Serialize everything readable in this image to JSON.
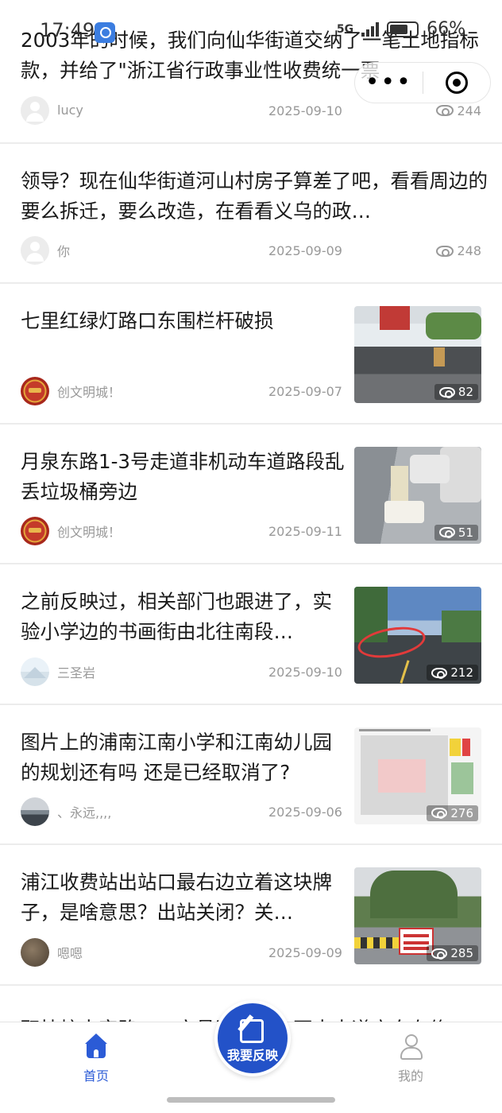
{
  "status_bar": {
    "time": "17:49",
    "network": "5G",
    "battery": "66%"
  },
  "capsule": {
    "more_icon": "more-dots-icon",
    "close_icon": "target-close-icon"
  },
  "feed": [
    {
      "title": "2003年的时候，我们向仙华街道交纳了一笔土地指标款，并给了\"浙江省行政事业性收费统一票",
      "author": "lucy",
      "date": "2025-09-10",
      "views": "244",
      "thumb": false
    },
    {
      "title": "领导？现在仙华街道河山村房子算差了吧，看看周边的要么拆迁，要么改造，在看看义乌的政…",
      "author": "你",
      "date": "2025-09-09",
      "views": "248",
      "thumb": false
    },
    {
      "title": "七里红绿灯路口东围栏杆破损",
      "author": "创文明城！",
      "date": "2025-09-07",
      "views": "82",
      "thumb": true
    },
    {
      "title": "月泉东路1-3号走道非机动车道路段乱丢垃圾桶旁边",
      "author": "创文明城！",
      "date": "2025-09-11",
      "views": "51",
      "thumb": true
    },
    {
      "title": "之前反映过，相关部门也跟进了，实验小学边的书画街由北往南段…",
      "author": "三圣岩",
      "date": "2025-09-10",
      "views": "212",
      "thumb": true
    },
    {
      "title": "图片上的浦南江南小学和江南幼儿园的规划还有吗 还是已经取消了?",
      "author": "、永远,,,,",
      "date": "2025-09-06",
      "views": "276",
      "thumb": true
    },
    {
      "title": "浦江收费站出站口最右边立着这块牌子，是啥意思？出站关闭？关…",
      "author": "嗯嗯",
      "date": "2025-09-09",
      "views": "285",
      "thumb": true
    },
    {
      "title": "职技校十字路口，文昌路……东亚大大道方向在修"
    }
  ],
  "fab": {
    "label": "我要反映"
  },
  "tabbar": {
    "home": "首页",
    "mine": "我的"
  },
  "colors": {
    "accent": "#2b5bd6",
    "fab": "#2352c8",
    "muted": "#999999"
  }
}
